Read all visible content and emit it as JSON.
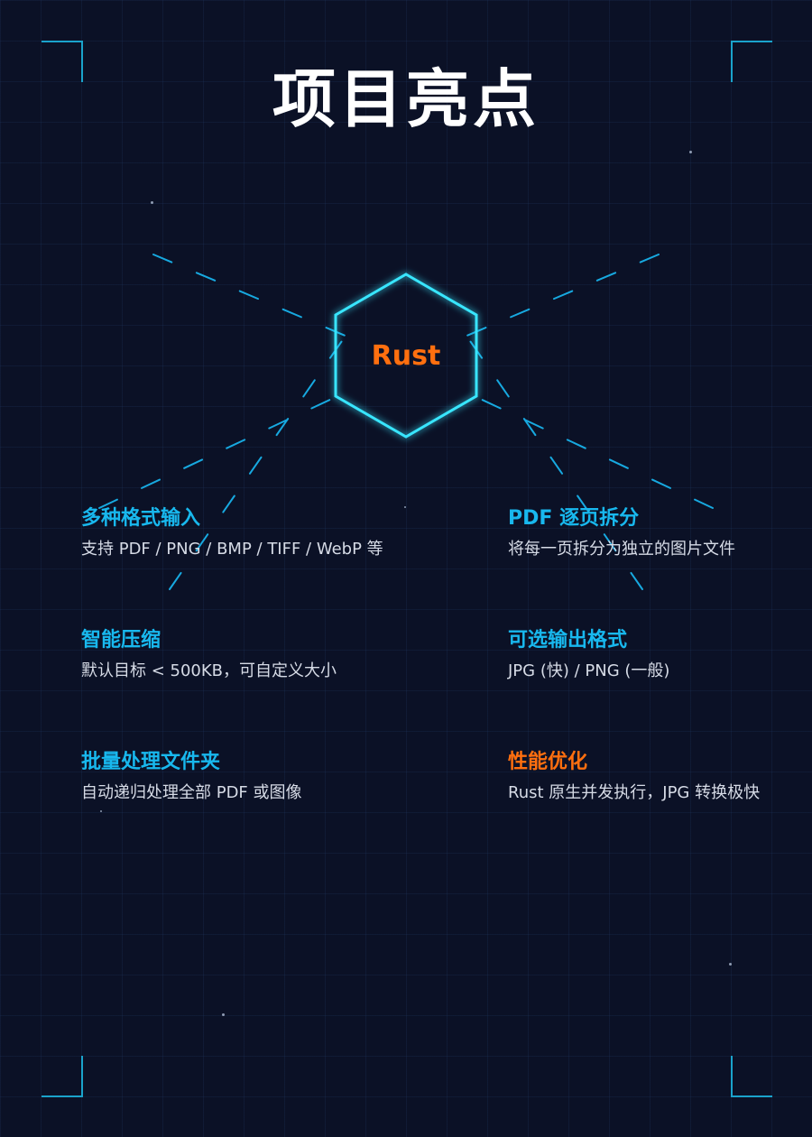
{
  "title": "项目亮点",
  "center_label": "Rust",
  "colors": {
    "background": "#0b1126",
    "heading": "#18b8ee",
    "accent": "#ff6f0f",
    "frame": "#1aa3cc",
    "hex_glow": "#39e6ff"
  },
  "features": [
    {
      "title": "多种格式输入",
      "desc": "支持 PDF / PNG / BMP / TIFF / WebP 等",
      "accent": false
    },
    {
      "title": "PDF 逐页拆分",
      "desc": "将每一页拆分为独立的图片文件",
      "accent": false
    },
    {
      "title": "智能压缩",
      "desc": "默认目标 < 500KB，可自定义大小",
      "accent": false
    },
    {
      "title": "可选输出格式",
      "desc": "JPG (快) / PNG (一般)",
      "accent": false
    },
    {
      "title": "批量处理文件夹",
      "desc": "自动递归处理全部 PDF 或图像",
      "accent": false
    },
    {
      "title": "性能优化",
      "desc": "Rust 原生并发执行，JPG 转换极快",
      "accent": true
    }
  ]
}
